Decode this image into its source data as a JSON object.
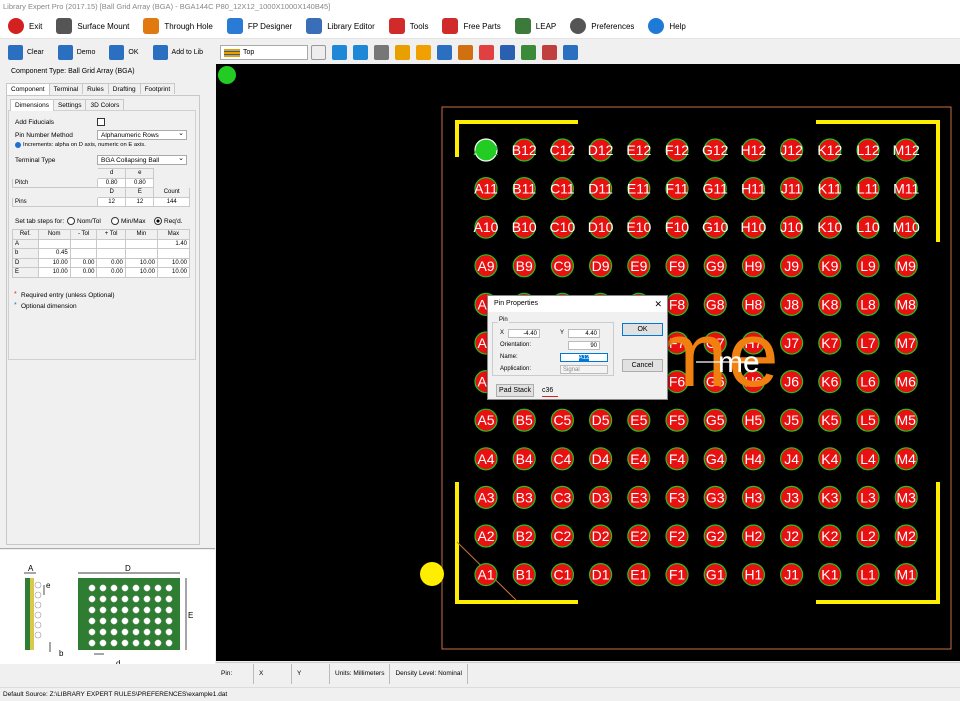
{
  "titlebar": {
    "text": "Library Expert Pro (2017.15) [Ball Grid Array (BGA) - BGA144C P80_12X12_1000X1000X140B45]"
  },
  "menu": [
    {
      "label": "Exit",
      "icon": "exit-icon",
      "color": "#d32020"
    },
    {
      "label": "Surface Mount",
      "icon": "chip-icon",
      "color": "#555"
    },
    {
      "label": "Through Hole",
      "icon": "through-hole-icon",
      "color": "#e07a10"
    },
    {
      "label": "FP Designer",
      "icon": "fp-designer-icon",
      "color": "#2a7bd6"
    },
    {
      "label": "Library Editor",
      "icon": "library-editor-icon",
      "color": "#3a6fb8"
    },
    {
      "label": "Tools",
      "icon": "tools-icon",
      "color": "#d02a2a"
    },
    {
      "label": "Free Parts",
      "icon": "free-parts-icon",
      "color": "#d02a2a"
    },
    {
      "label": "LEAP",
      "icon": "leap-icon",
      "color": "#3c7a3c"
    },
    {
      "label": "Preferences",
      "icon": "gear-icon",
      "color": "#555"
    },
    {
      "label": "Help",
      "icon": "help-icon",
      "color": "#1e7ad6"
    }
  ],
  "lefttools": [
    {
      "label": "Clear",
      "icon": "clear-icon"
    },
    {
      "label": "Demo",
      "icon": "demo-icon"
    },
    {
      "label": "OK",
      "icon": "ok-icon"
    },
    {
      "label": "Add to Lib",
      "icon": "add-to-lib-icon"
    }
  ],
  "component_type": "Component Type: Ball Grid Array (BGA)",
  "main_tabs": [
    "Component",
    "Terminal",
    "Rules",
    "Drafting",
    "Footprint"
  ],
  "sub_tabs": [
    "Dimensions",
    "Settings",
    "3D Colors"
  ],
  "form": {
    "add_fiducials": "Add Fiducials",
    "pin_number_method_label": "Pin Number Method",
    "pin_number_method_value": "Alphanumeric Rows",
    "increments_note": "Increments: alpha on D axis, numeric on E axis.",
    "terminal_type_label": "Terminal Type",
    "terminal_type_value": "BGA Collapsing Ball",
    "pitch_label": "Pitch",
    "pitch_d": "0.80",
    "pitch_e": "0.80",
    "col_d": "d",
    "col_e": "e",
    "pins_label": "Pins",
    "pins_D": "12",
    "pins_E": "12",
    "pins_count": "144",
    "hdr_D": "D",
    "hdr_E": "E",
    "hdr_count": "Count",
    "tab_steps_label": "Set tab steps for:",
    "radio_nom": "Nom/Tol",
    "radio_minmax": "Min/Max",
    "radio_reqd": "Req'd.",
    "dim_headers": [
      "Ref.",
      "Nom",
      "- Tol",
      "+ Tol",
      "Min",
      "Max"
    ],
    "dims": [
      {
        "ref": "A",
        "nom": "",
        "mtol": "",
        "ptol": "",
        "min": "",
        "max": "1.40"
      },
      {
        "ref": "b",
        "nom": "0.45",
        "mtol": "",
        "ptol": "",
        "min": "",
        "max": ""
      },
      {
        "ref": "D",
        "nom": "10.00",
        "mtol": "0.00",
        "ptol": "0.00",
        "min": "10.00",
        "max": "10.00"
      },
      {
        "ref": "E",
        "nom": "10.00",
        "mtol": "0.00",
        "ptol": "0.00",
        "min": "10.00",
        "max": "10.00"
      }
    ],
    "required_note": "Required entry (unless Optional)",
    "optional_note": "Optional dimension"
  },
  "diagram": {
    "A": "A",
    "D": "D",
    "E": "E",
    "e": "e",
    "b": "b",
    "d": "d"
  },
  "canvas_toolbar": {
    "layer": "Top"
  },
  "pcb": {
    "cols": [
      "A",
      "B",
      "C",
      "D",
      "E",
      "F",
      "G",
      "H",
      "J",
      "K",
      "L",
      "M"
    ],
    "rows": [
      "12",
      "11",
      "10",
      "9",
      "8",
      "7",
      "6",
      "5",
      "4",
      "3",
      "2",
      "1"
    ],
    "big_text": "me",
    "small_text": "me"
  },
  "dialog": {
    "title": "Pin Properties",
    "group": "Pin",
    "x_label": "X",
    "x_value": "-4.40",
    "y_label": "Y",
    "y_value": "4.40",
    "orientation_label": "Orientation:",
    "orientation_value": "90",
    "name_label": "Name:",
    "name_value": "A12",
    "application_label": "Application:",
    "application_value": "Signal",
    "padstack_button": "Pad Stack",
    "padstack_value": "c36",
    "ok": "OK",
    "cancel": "Cancel"
  },
  "status": {
    "pin": "Pin:",
    "x": "X",
    "y": "Y",
    "units": "Units: Millimeters",
    "density": "Density Level: Nominal"
  },
  "bottom": "Default Source:  Z:\\LIBRARY EXPERT RULES\\PREFERENCES\\example1.dat",
  "colors": {
    "pad": "#e81010",
    "pad_ring": "#22c422",
    "outline": "#ffee00",
    "courtyard": "#c87040",
    "label": "#ffffff",
    "text_orange": "#f08010"
  }
}
